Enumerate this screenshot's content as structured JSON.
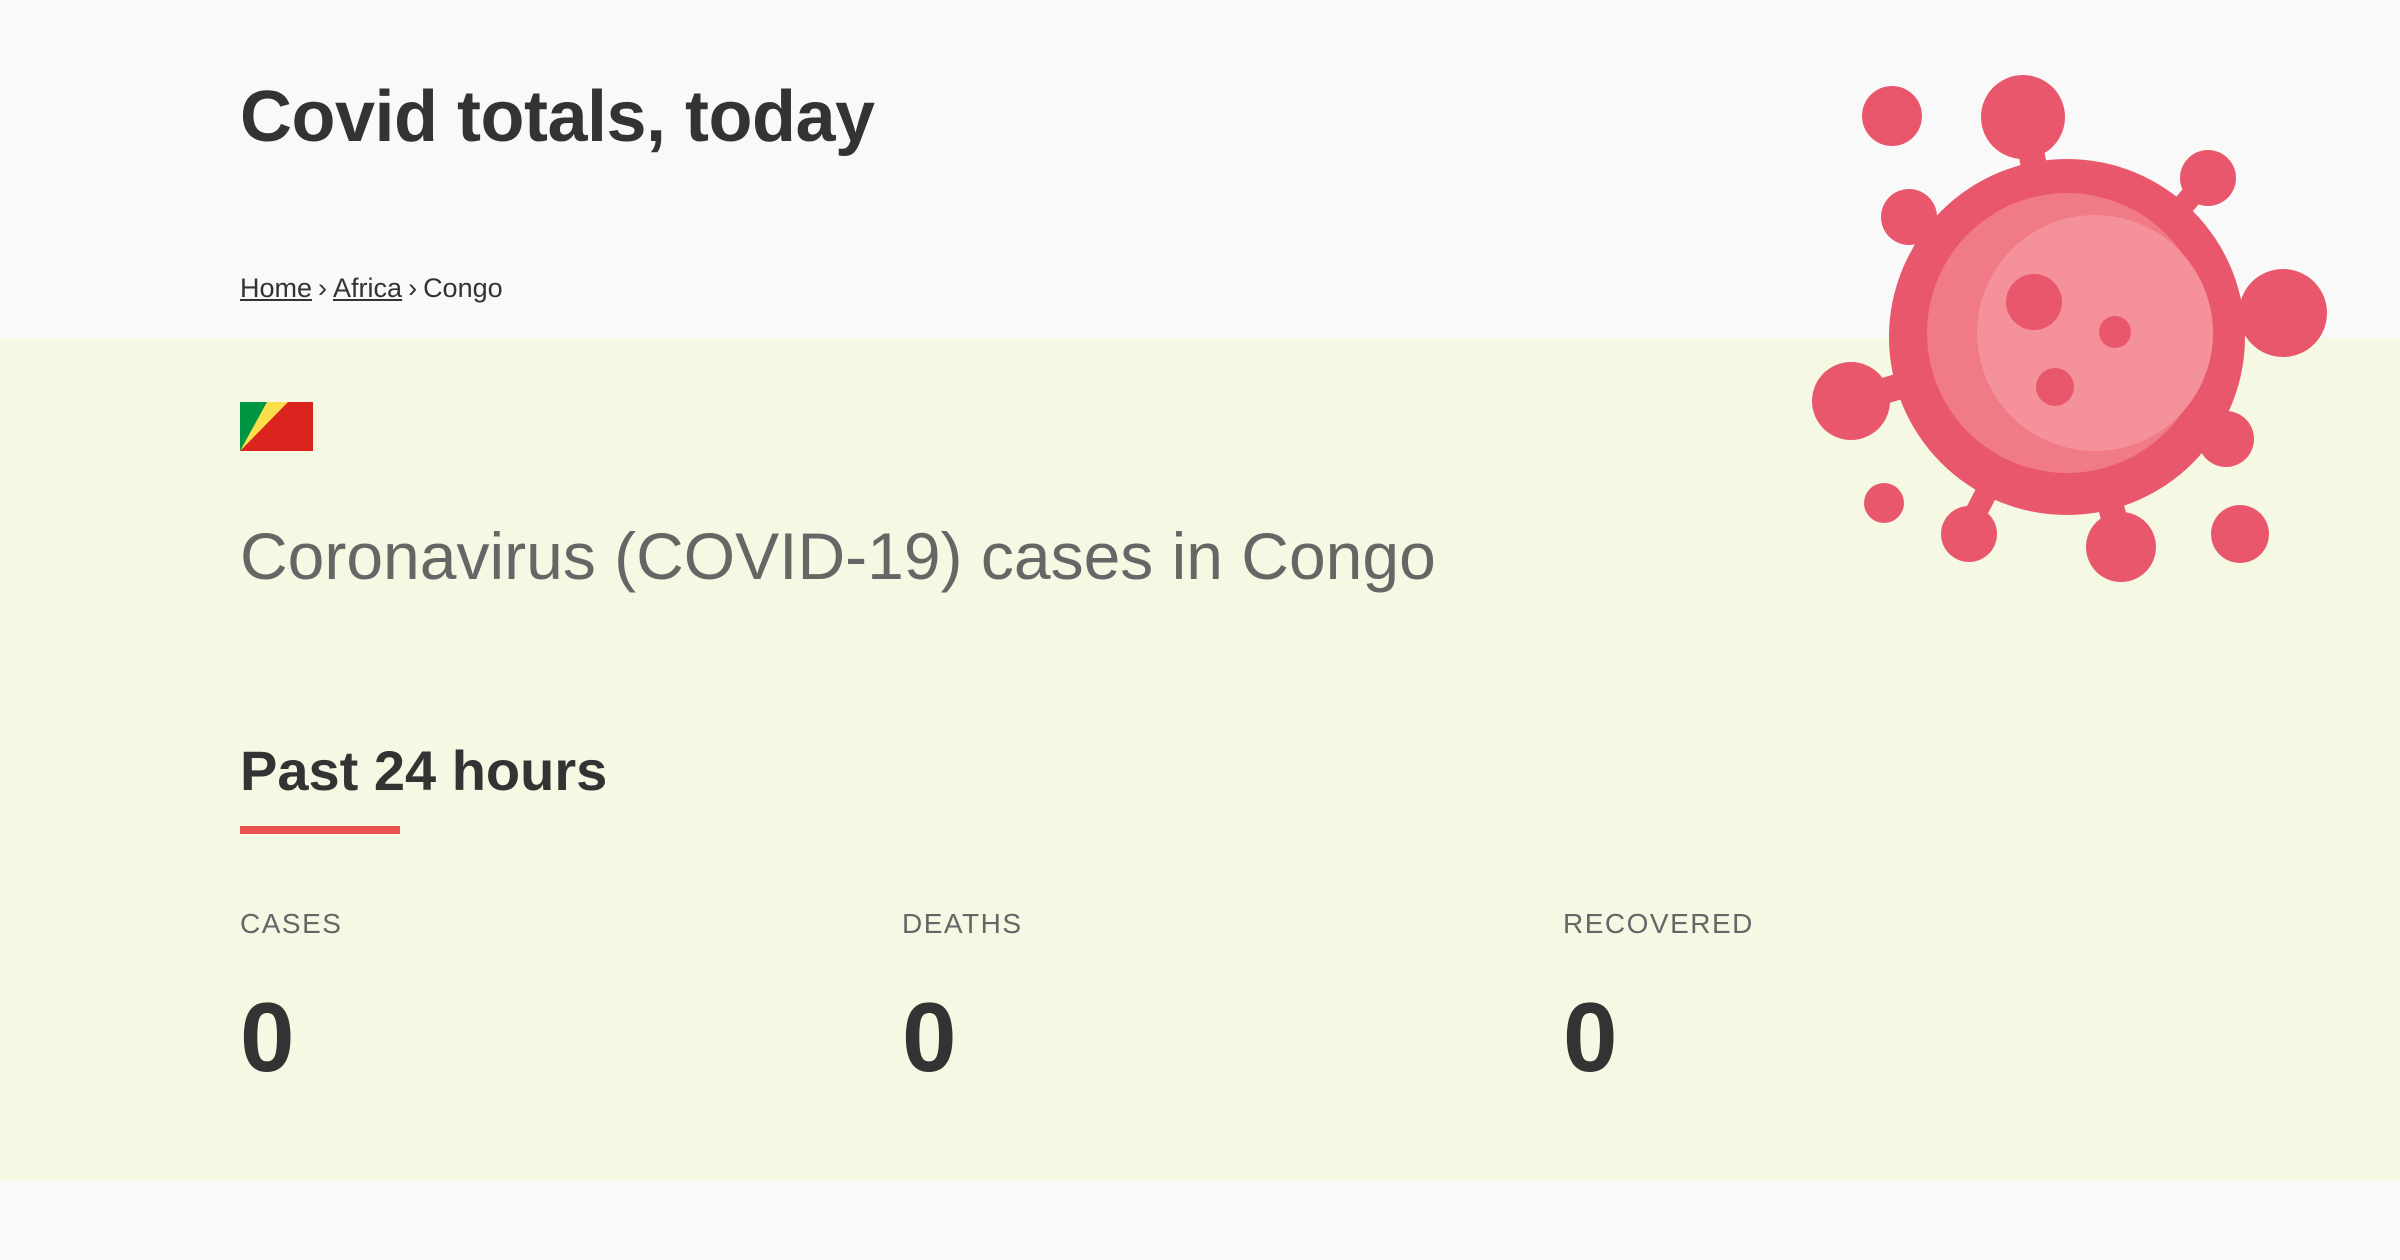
{
  "header": {
    "site_title": "Covid totals, today"
  },
  "breadcrumb": {
    "items": [
      {
        "label": "Home"
      },
      {
        "label": "Africa"
      }
    ],
    "current": "Congo",
    "separator": "›"
  },
  "country": {
    "flag": {
      "colors": [
        "#009543",
        "#fbde4a",
        "#dc241f"
      ]
    },
    "page_heading": "Coronavirus (COVID-19) cases in Congo"
  },
  "section": {
    "title": "Past 24 hours",
    "accent_color": "#e8534f"
  },
  "stats": [
    {
      "label": "CASES",
      "value": "0"
    },
    {
      "label": "DEATHS",
      "value": "0"
    },
    {
      "label": "RECOVERED",
      "value": "0"
    }
  ],
  "decoration": {
    "icon": "virus-icon",
    "color": "#e9576d"
  },
  "theme": {
    "panel_background": "#f5f8e2",
    "page_background": "#f9f9f9"
  }
}
